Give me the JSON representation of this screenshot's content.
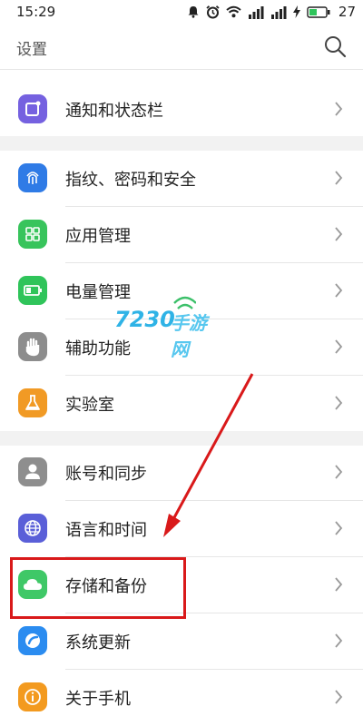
{
  "status_bar": {
    "time": "15:29",
    "battery_level": "27"
  },
  "header": {
    "title": "设置"
  },
  "sections": [
    {
      "items": [
        {
          "label": "通知和状态栏",
          "icon": "notification-icon",
          "color": "#7561e0"
        }
      ]
    },
    {
      "items": [
        {
          "label": "指纹、密码和安全",
          "icon": "fingerprint-icon",
          "color": "#2f7be6"
        },
        {
          "label": "应用管理",
          "icon": "apps-grid-icon",
          "color": "#38c45c"
        },
        {
          "label": "电量管理",
          "icon": "battery-icon",
          "color": "#2fc45a"
        },
        {
          "label": "辅助功能",
          "icon": "hand-icon",
          "color": "#8d8d8d"
        },
        {
          "label": "实验室",
          "icon": "flask-icon",
          "color": "#f19a25"
        }
      ]
    },
    {
      "items": [
        {
          "label": "账号和同步",
          "icon": "account-icon",
          "color": "#8e8e8e"
        },
        {
          "label": "语言和时间",
          "icon": "globe-icon",
          "color": "#5a5fd8"
        },
        {
          "label": "存储和备份",
          "icon": "cloud-icon",
          "color": "#3fc867"
        },
        {
          "label": "系统更新",
          "icon": "update-icon",
          "color": "#2b8cf0"
        },
        {
          "label": "关于手机",
          "icon": "info-icon",
          "color": "#f39a1f"
        }
      ]
    }
  ],
  "annotation": {
    "highlighted_item": "存储和备份",
    "color": "#d9191a"
  },
  "watermark": {
    "number": "7230",
    "text": "手游网"
  }
}
